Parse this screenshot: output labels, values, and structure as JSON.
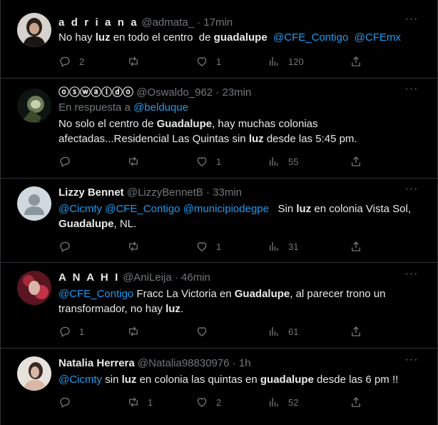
{
  "tweets": [
    {
      "name": "a d r i a n a",
      "handle": "@admata_",
      "sep": "·",
      "time": "17min",
      "reply_label": "",
      "reply_mention": "",
      "text_parts": [
        {
          "t": "No hay "
        },
        {
          "t": "luz",
          "b": true
        },
        {
          "t": " en todo el centro  de "
        },
        {
          "t": "guadalupe",
          "b": true
        },
        {
          "t": "  "
        },
        {
          "t": "@CFE_Contigo",
          "m": true
        },
        {
          "t": "  "
        },
        {
          "t": "@CFEmx",
          "m": true
        }
      ],
      "replies": "2",
      "retweets": "",
      "likes": "1",
      "views": "120",
      "avatar_color": "#6b5a52"
    },
    {
      "name": "ⓞⓢⓦⓐⓛⓓⓞ",
      "handle": "@Oswaldo_962",
      "sep": "·",
      "time": "23min",
      "reply_label": "En respuesta a ",
      "reply_mention": "@belduque",
      "text_parts": [
        {
          "t": "No solo el centro de "
        },
        {
          "t": "Guadalupe",
          "b": true
        },
        {
          "t": ", hay muchas colonias afectadas...Residencial Las Quintas sin "
        },
        {
          "t": "luz",
          "b": true
        },
        {
          "t": " desde las 5:45 pm."
        }
      ],
      "replies": "",
      "retweets": "",
      "likes": "1",
      "views": "55",
      "avatar_color": "#2a3a22"
    },
    {
      "name": "Lizzy Bennet",
      "handle": "@LizzyBennetB",
      "sep": "·",
      "time": "33min",
      "reply_label": "",
      "reply_mention": "",
      "text_parts": [
        {
          "t": "@Cicmty",
          "m": true
        },
        {
          "t": " "
        },
        {
          "t": "@CFE_Contigo",
          "m": true
        },
        {
          "t": " "
        },
        {
          "t": "@municipiodegpe",
          "m": true
        },
        {
          "t": "   Sin "
        },
        {
          "t": "luz",
          "b": true
        },
        {
          "t": " en colonia Vista Sol, "
        },
        {
          "t": "Guadalupe",
          "b": true
        },
        {
          "t": ", NL."
        }
      ],
      "replies": "",
      "retweets": "",
      "likes": "1",
      "views": "31",
      "avatar_color": "#cfd9de"
    },
    {
      "name": "A N A H I",
      "handle": "@AniLeija",
      "sep": "·",
      "time": "46min",
      "reply_label": "",
      "reply_mention": "",
      "text_parts": [
        {
          "t": "@CFE_Contigo",
          "m": true
        },
        {
          "t": " Fracc La Victoria en "
        },
        {
          "t": "Guadalupe",
          "b": true
        },
        {
          "t": ", al parecer trono un transformador, no hay "
        },
        {
          "t": "luz",
          "b": true
        },
        {
          "t": "."
        }
      ],
      "replies": "1",
      "retweets": "",
      "likes": "",
      "views": "61",
      "avatar_color": "#8a1f2c"
    },
    {
      "name": "Natalia Herrera",
      "handle": "@Natalia98830976",
      "sep": "·",
      "time": "1h",
      "reply_label": "",
      "reply_mention": "",
      "text_parts": [
        {
          "t": "@Cicmty",
          "m": true
        },
        {
          "t": " sin "
        },
        {
          "t": "luz",
          "b": true
        },
        {
          "t": " en colonia las quintas en "
        },
        {
          "t": "guadalupe",
          "b": true
        },
        {
          "t": " desde las 6 pm !!"
        }
      ],
      "replies": "",
      "retweets": "1",
      "likes": "2",
      "views": "52",
      "avatar_color": "#c9a99a"
    }
  ],
  "more_label": "···"
}
